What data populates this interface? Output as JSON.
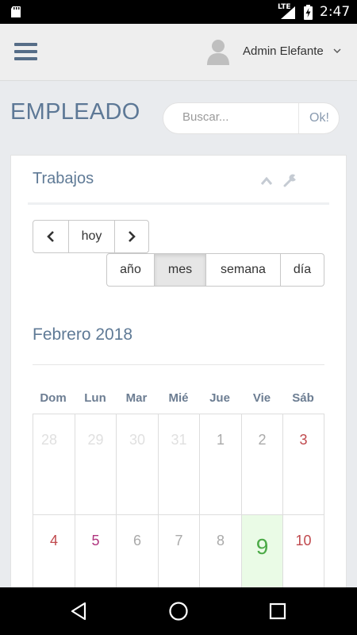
{
  "status_bar": {
    "time": "2:47",
    "network": "LTE"
  },
  "header": {
    "user_name": "Admin Elefante"
  },
  "page": {
    "title": "EMPLEADO"
  },
  "search": {
    "placeholder": "Buscar...",
    "button_label": "Ok!"
  },
  "portlet": {
    "title": "Trabajos"
  },
  "toolbar": {
    "prev_label": "<",
    "today_label": "hoy",
    "next_label": ">",
    "views": [
      {
        "label": "año",
        "active": false
      },
      {
        "label": "mes",
        "active": true
      },
      {
        "label": "semana",
        "active": false
      },
      {
        "label": "día",
        "active": false
      }
    ]
  },
  "calendar": {
    "month_title": "Febrero 2018",
    "weekdays": [
      "Dom",
      "Lun",
      "Mar",
      "Mié",
      "Jue",
      "Vie",
      "Sáb"
    ],
    "weeks": [
      [
        "28",
        "29",
        "30",
        "31",
        "1",
        "2",
        "3"
      ],
      [
        "4",
        "5",
        "6",
        "7",
        "8",
        "9",
        "10"
      ]
    ],
    "today": "9",
    "colors": {
      "other_month": "#e0e0e0",
      "weekday": "#aaaaaa",
      "saturday": "#c0494d",
      "sunday_week2": "#c0494d",
      "monday_week2": "#b0357f",
      "today_bg": "#eafbe6",
      "today_text": "#4caa47"
    }
  },
  "accent_color": "#5f7a96"
}
